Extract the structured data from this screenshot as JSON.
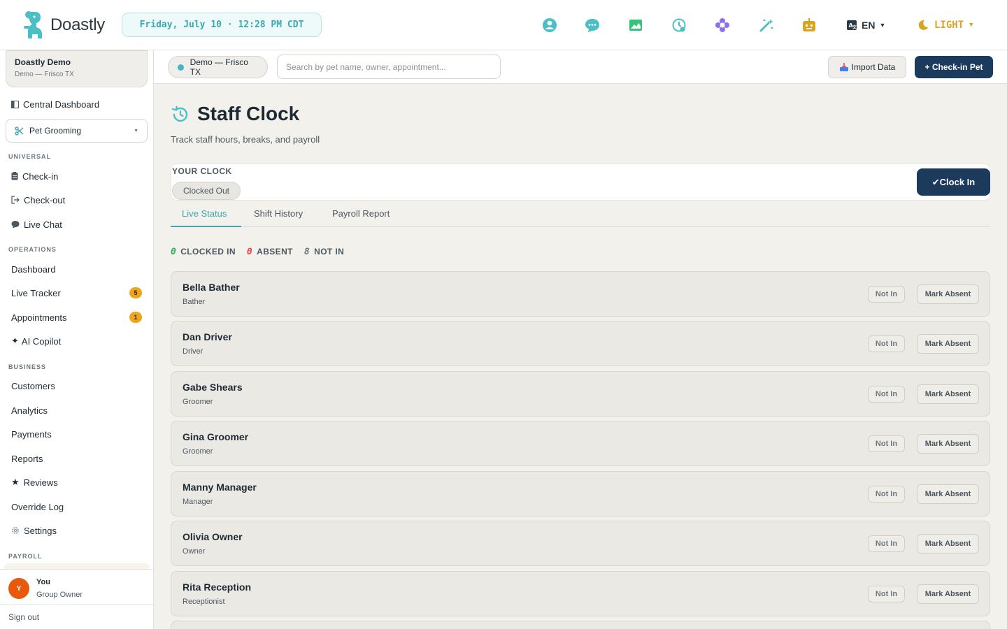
{
  "app": {
    "brand": "Doastly",
    "datetime": "Friday, July 10 · 12:28 PM CDT",
    "language": "EN",
    "theme": "LIGHT",
    "accent": "#3aa9b0",
    "primary": "#1b3a5c"
  },
  "top_icons": [
    "staff-icon",
    "chat-bubble-icon",
    "image-icon",
    "clock-history-icon",
    "flower-icon",
    "magic-wand-icon",
    "robot-icon"
  ],
  "sidebar": {
    "org_name": "Doastly Demo",
    "org_location": "Demo — Frisco TX",
    "central_dashboard": "Central Dashboard",
    "module": "Pet Grooming",
    "sections": {
      "universal": "UNIVERSAL",
      "operations": "OPERATIONS",
      "business": "BUSINESS",
      "payroll": "PAYROLL"
    },
    "universal_items": [
      "Check-in",
      "Check-out",
      "Live Chat"
    ],
    "operations_items": [
      "Dashboard",
      "Live Tracker",
      "Appointments",
      "AI Copilot"
    ],
    "badges": {
      "live_tracker": "5",
      "appointments": "1"
    },
    "business_items": [
      "Customers",
      "Analytics",
      "Payments",
      "Reports",
      "Reviews",
      "Override Log",
      "Settings"
    ],
    "user": {
      "initial": "Y",
      "name": "You",
      "role": "Group Owner"
    },
    "sign_out": "Sign out"
  },
  "subheader": {
    "location": "Demo — Frisco TX",
    "search_placeholder": "Search by pet name, owner, appointment...",
    "import_label": "Import Data",
    "checkin_label": "+ Check-in Pet"
  },
  "page": {
    "title": "Staff Clock",
    "subtitle": "Track staff hours, breaks, and payroll",
    "your_clock_label": "YOUR CLOCK",
    "clock_status": "Clocked Out",
    "clock_in_label": "✔Clock In",
    "tabs": [
      "Live Status",
      "Shift History",
      "Payroll Report"
    ],
    "counters": {
      "clocked_in_count": "0",
      "clocked_in_label": "CLOCKED IN",
      "absent_count": "0",
      "absent_label": "ABSENT",
      "not_in_count": "8",
      "not_in_label": "NOT IN"
    },
    "status_label": "Not In",
    "action_label": "Mark Absent",
    "staff": [
      {
        "name": "Bella Bather",
        "role": "Bather"
      },
      {
        "name": "Dan Driver",
        "role": "Driver"
      },
      {
        "name": "Gabe Shears",
        "role": "Groomer"
      },
      {
        "name": "Gina Groomer",
        "role": "Groomer"
      },
      {
        "name": "Manny Manager",
        "role": "Manager"
      },
      {
        "name": "Olivia Owner",
        "role": "Owner"
      },
      {
        "name": "Rita Reception",
        "role": "Receptionist"
      }
    ]
  }
}
